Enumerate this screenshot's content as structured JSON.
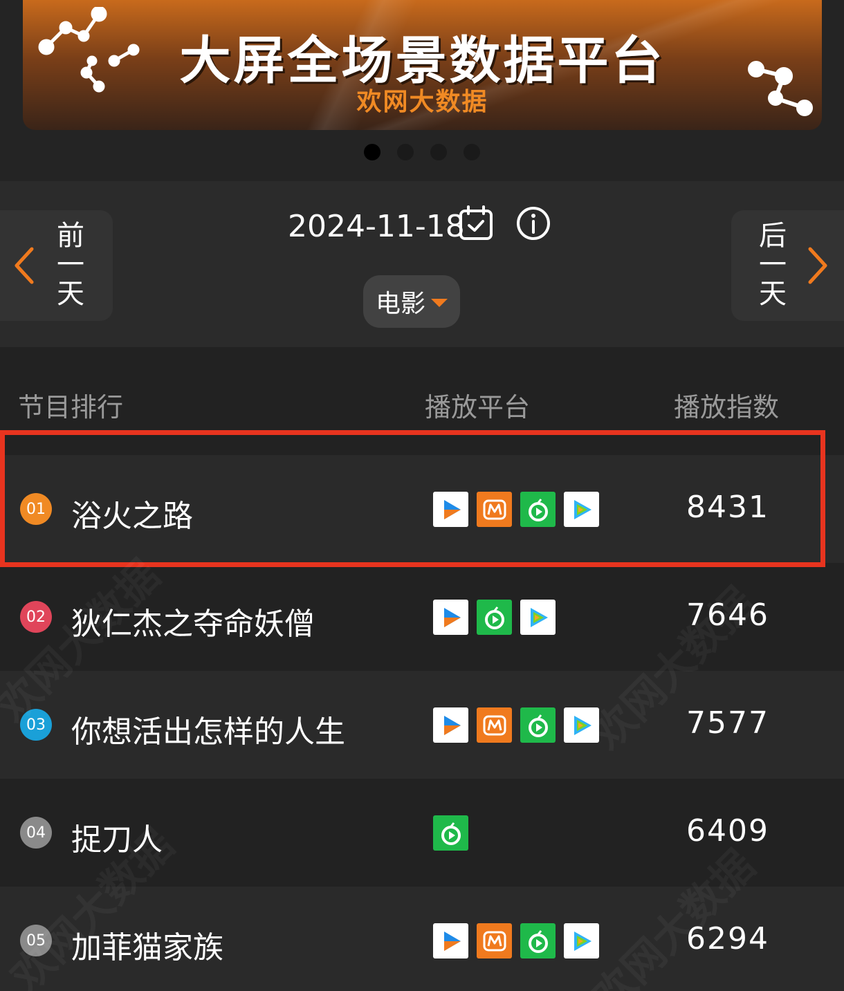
{
  "banner": {
    "title": "大屏全场景数据平台",
    "subtitle": "欢网大数据",
    "active_dot_index": 0,
    "dot_count": 4
  },
  "nav": {
    "prev_label": "前一天",
    "next_label": "后一天",
    "date": "2024-11-18",
    "calendar_icon": "calendar-check-icon",
    "info_icon": "info-icon",
    "category": "电影"
  },
  "table": {
    "headers": {
      "rank": "节目排行",
      "platform": "播放平台",
      "index": "播放指数"
    },
    "rows": [
      {
        "rank": "01",
        "title": "浴火之路",
        "platforms": [
          "youku",
          "mgtv",
          "iqiyi",
          "tencent"
        ],
        "score": "8431"
      },
      {
        "rank": "02",
        "title": "狄仁杰之夺命妖僧",
        "platforms": [
          "youku",
          "iqiyi",
          "tencent"
        ],
        "score": "7646"
      },
      {
        "rank": "03",
        "title": "你想活出怎样的人生",
        "platforms": [
          "youku",
          "mgtv",
          "iqiyi",
          "tencent"
        ],
        "score": "7577"
      },
      {
        "rank": "04",
        "title": "捉刀人",
        "platforms": [
          "iqiyi"
        ],
        "score": "6409"
      },
      {
        "rank": "05",
        "title": "加菲猫家族",
        "platforms": [
          "youku",
          "mgtv",
          "iqiyi",
          "tencent"
        ],
        "score": "6294"
      }
    ]
  },
  "colors": {
    "accent": "#f07a1e",
    "highlight_border": "#e8341f",
    "rank_1": "#f08a24",
    "rank_2": "#e0455a",
    "rank_3": "#1aa0d8",
    "rank_other": "#8a8a8a",
    "youku_bg": "#ffffff",
    "mgtv_bg": "#f07a1e",
    "iqiyi_bg": "#1fb94a",
    "tencent_bg": "#ffffff"
  }
}
